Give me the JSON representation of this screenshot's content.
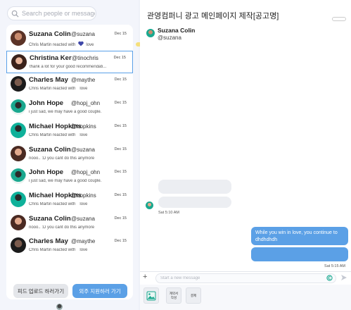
{
  "search": {
    "placeholder": "Search people or message"
  },
  "conversations": [
    {
      "name": "Suzana Colin",
      "handle": "@suzana",
      "date": "Dec 15",
      "preview_prefix": "Chris Martin reacted with",
      "preview_suffix": "love",
      "heart": true,
      "selected": false
    },
    {
      "name": "Christina Ker",
      "handle": "@tinochris",
      "date": "Dec 15",
      "preview": "thank a lot for your good recommendati...",
      "selected": true
    },
    {
      "name": "Charles May",
      "handle": "@maythe",
      "date": "Dec 15",
      "preview_prefix": "Chris Martin reacted with",
      "preview_suffix": "love",
      "heart": false
    },
    {
      "name": "John Hope",
      "handle": "@hopj_ohn",
      "date": "Dec 15",
      "preview": "i just sad, we may have a good couple."
    },
    {
      "name": "Michael Hopkins",
      "handle": "@hopkins",
      "date": "Dec 15",
      "preview_prefix": "Chris Martin reacted with",
      "preview_suffix": "love",
      "heart": false
    },
    {
      "name": "Suzana Colin",
      "handle": "@suzana",
      "date": "Dec 15",
      "preview": "nooo.. :D you cant do this anymore"
    },
    {
      "name": "John Hope",
      "handle": "@hopj_ohn",
      "date": "Dec 15",
      "preview": "i just sad, we may have a good couple."
    },
    {
      "name": "Michael Hopkins",
      "handle": "@hopkins",
      "date": "Dec 15",
      "preview_prefix": "Chris Martin reacted with",
      "preview_suffix": "love",
      "heart": false
    },
    {
      "name": "Suzana Colin",
      "handle": "@suzana",
      "date": "Dec 15",
      "preview": "nooo.. :D you cant do this anymore"
    },
    {
      "name": "Charles May",
      "handle": "@maythe",
      "date": "Dec 15",
      "preview_prefix": "Chris Martin reacted with",
      "preview_suffix": "love",
      "heart": false
    }
  ],
  "buttons": {
    "feed_upload": "피드 업로드 하러가기",
    "apply": "외주 지원하러 가기"
  },
  "chat": {
    "title": "관영컴퍼니 광고 메인페이지 제작[공고명]",
    "contact_name": "Suzana Colin",
    "contact_handle": "@suzana",
    "incoming_time": "Sat 5:10 AM",
    "outgoing_text_line1": "While you win in love, you continue to",
    "outgoing_text_line2": "dhdhdhdh",
    "outgoing_time": "Sat 5:15 AM",
    "input_placeholder": "Start a new message"
  },
  "tools": {
    "contract": "계약서\n작성",
    "pay": "결제"
  },
  "colors": {
    "accent": "#5ba0e6",
    "heart": "#3d46a8",
    "panel_bg": "#f3f5fb"
  }
}
